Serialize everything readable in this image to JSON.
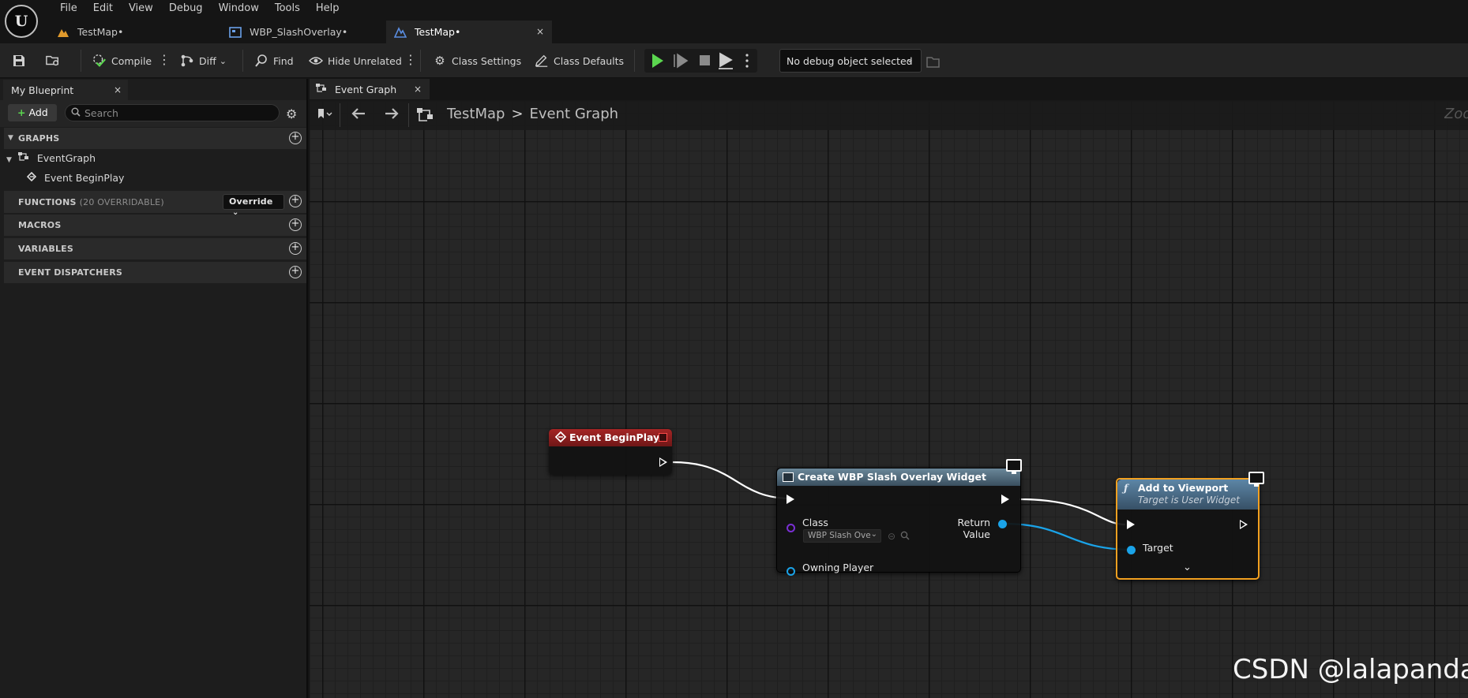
{
  "app": {
    "logo_text": "U",
    "menu": [
      "File",
      "Edit",
      "View",
      "Debug",
      "Window",
      "Tools",
      "Help"
    ],
    "tabs": [
      {
        "label": "TestMap•",
        "icon": "map-icon"
      },
      {
        "label": "WBP_SlashOverlay•",
        "icon": "widget-blueprint-icon"
      },
      {
        "label": "TestMap•",
        "icon": "level-blueprint-icon",
        "close": "×"
      }
    ]
  },
  "toolbar": {
    "compile": "Compile",
    "diff": "Diff",
    "find": "Find",
    "hide_unrelated": "Hide Unrelated",
    "class_settings": "Class Settings",
    "class_defaults": "Class Defaults",
    "debug_object": "No debug object selected",
    "play_color": "#5bd64f"
  },
  "left_panel": {
    "tab_label": "My Blueprint",
    "add_label": "Add",
    "search_placeholder": "Search",
    "graphs_header": "GRAPHS",
    "event_graph": "EventGraph",
    "event_beginplay": "Event BeginPlay",
    "functions_header": "FUNCTIONS",
    "functions_sub": "(20 OVERRIDABLE)",
    "override_label": "Override",
    "macros_header": "MACROS",
    "variables_header": "VARIABLES",
    "dispatchers_header": "EVENT DISPATCHERS"
  },
  "graph": {
    "tab_label": "Event Graph",
    "breadcrumb": [
      "TestMap",
      "Event Graph"
    ],
    "breadcrumb_sep": ">",
    "zoom_label": "Zoom",
    "nodes": {
      "begin_play": {
        "title": "Event BeginPlay",
        "color": "#8c1f1f"
      },
      "create_widget": {
        "title": "Create WBP Slash Overlay Widget",
        "class_label": "Class",
        "class_value": "WBP Slash Ove",
        "owning_player": "Owning Player",
        "return_value": "Return Value",
        "color": "#4f6a7f"
      },
      "add_viewport": {
        "title": "Add to Viewport",
        "subtitle": "Target is User Widget",
        "target": "Target",
        "color": "#4d6f8a",
        "selection_color": "#f2a020"
      }
    },
    "pin_color_object": "#1aa3e8",
    "pin_color_class": "#7a2fd4"
  },
  "watermark": "CSDN @lalapanda"
}
